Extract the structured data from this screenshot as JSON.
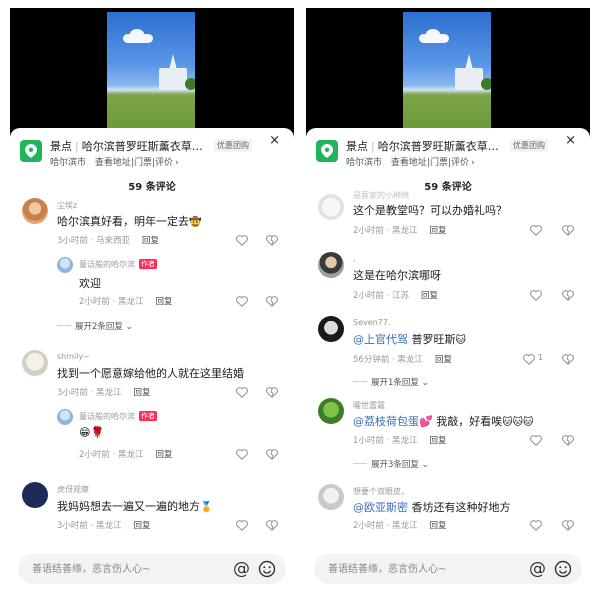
{
  "panels": [
    {
      "poi": {
        "category": "景点",
        "name": "哈尔滨普罗旺斯薰衣草…",
        "badge": "优惠团购",
        "city": "哈尔滨市",
        "link_address": "查看地址",
        "link_tickets": "门票",
        "link_reviews": "评价",
        "chevron": "›"
      },
      "close": "×",
      "comment_count": "59 条评论",
      "comments": [
        {
          "user": "尘埃z",
          "text": "哈尔滨真好看，明年一定去",
          "emoji": "🤠",
          "time": "3小时前 · 马来西亚",
          "reply": "回复",
          "reply_to": {
            "user": "童话般的哈尔滨",
            "tag": "作者",
            "text": "欢迎",
            "time": "2小时前 · 黑龙江",
            "reply": "回复"
          },
          "expand": "展开2条回复"
        },
        {
          "user": "shmily~",
          "text": "找到一个愿意嫁给他的人就在这里结婚",
          "time": "3小时前 · 黑龙江",
          "reply": "回复",
          "reply_to": {
            "user": "童话般的哈尔滨",
            "tag": "作者",
            "text": "😁🌹",
            "time": "2小时前 · 黑龙江",
            "reply": "回复"
          }
        },
        {
          "user": "虎伢观察",
          "text": "我妈妈想去一遍又一遍的地方",
          "emoji": "🏅",
          "time": "3小时前 · 黑龙江",
          "reply": "回复"
        }
      ],
      "input": {
        "placeholder": "善语结善缘，恶言伤人心~",
        "at": "@"
      }
    },
    {
      "poi": {
        "category": "景点",
        "name": "哈尔滨普罗旺斯薰衣草…",
        "badge": "优惠团购",
        "city": "哈尔滨市",
        "link_address": "查看地址",
        "link_tickets": "门票",
        "link_reviews": "评价",
        "chevron": "›"
      },
      "close": "×",
      "comment_count": "59 条评论",
      "comments": [
        {
          "user": "是蓉家的小绵绵",
          "text": "这个是教堂吗？可以办婚礼吗？",
          "time": "2小时前 · 黑龙江",
          "reply": "回复"
        },
        {
          "user": ",",
          "text": "这是在哈尔滨哪呀",
          "time": "2小时前 · 江苏",
          "reply": "回复"
        },
        {
          "user": "Seven77.",
          "mention": "@上官代驾",
          "text": "普罗旺斯",
          "emoji": "🐱",
          "time": "56分钟前 · 黑龙江",
          "reply": "回复",
          "likes": "1",
          "expand": "展开1条回复"
        },
        {
          "user": "曜世雷霆",
          "mention": "@荔枝荷包蛋💕",
          "text": "我敲，好看唉",
          "emoji": "🐱🐱🐱",
          "time": "1小时前 · 黑龙江",
          "reply": "回复",
          "expand": "展开3条回复"
        },
        {
          "user": "想要个双眼皮。",
          "mention": "@欧亚斯密",
          "text": "香坊还有这种好地方",
          "time": "2小时前 · 黑龙江",
          "reply": "回复"
        }
      ],
      "input": {
        "placeholder": "善语结善缘，恶言伤人心~",
        "at": "@"
      }
    }
  ],
  "colors": {
    "poi_green": "#20b45c",
    "author_tag": "#fe2c55",
    "mention_blue": "#3a6bb5"
  }
}
